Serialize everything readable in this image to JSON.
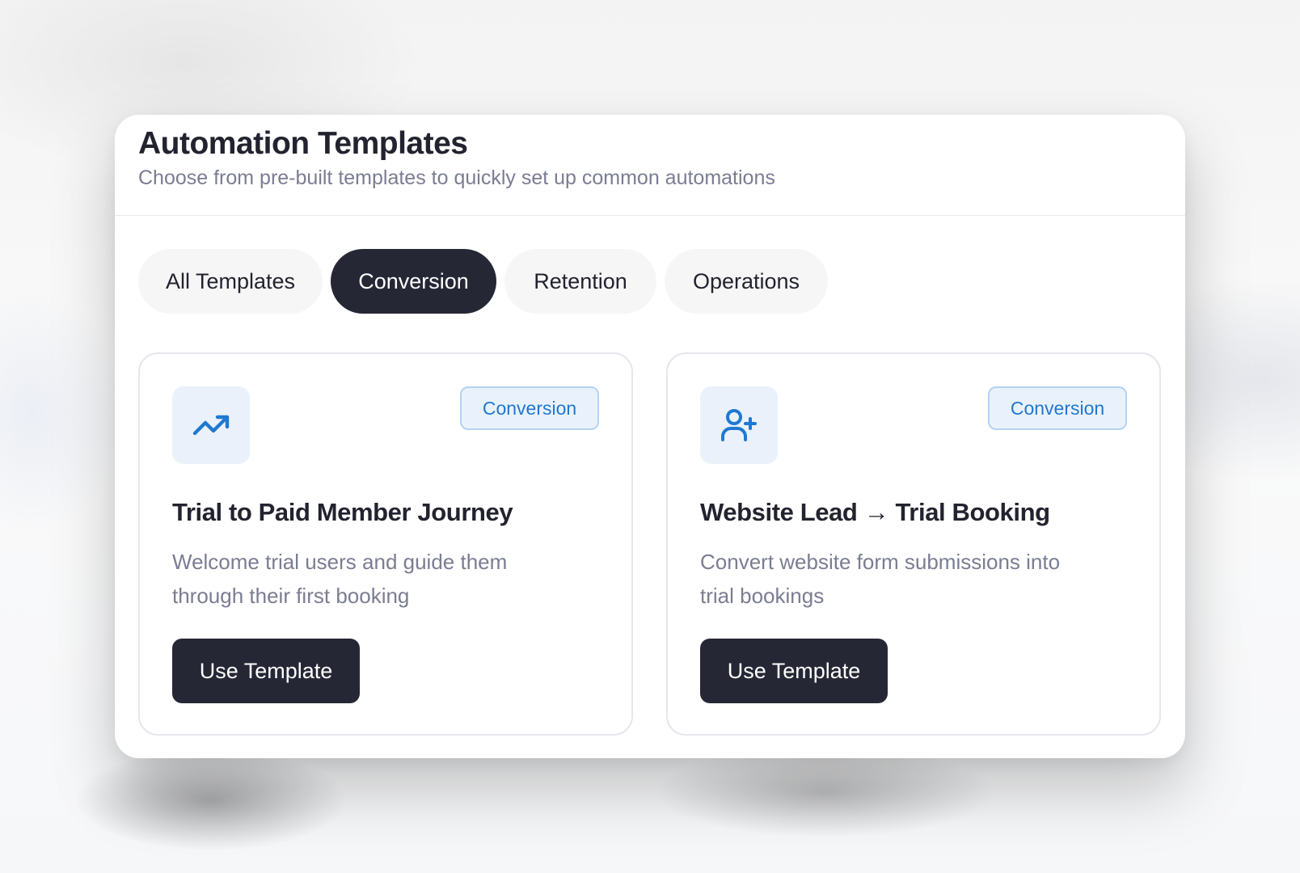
{
  "header": {
    "title": "Automation Templates",
    "subtitle": "Choose from pre-built templates to quickly set up common automations"
  },
  "tabs": [
    {
      "label": "All Templates",
      "active": false
    },
    {
      "label": "Conversion",
      "active": true
    },
    {
      "label": "Retention",
      "active": false
    },
    {
      "label": "Operations",
      "active": false
    }
  ],
  "templates": [
    {
      "icon": "trending-up-icon",
      "badge": "Conversion",
      "title": "Trial to Paid Member Journey",
      "description": "Welcome trial users and guide them through their first booking",
      "button_label": "Use Template"
    },
    {
      "icon": "user-plus-icon",
      "badge": "Conversion",
      "title": "Website Lead → Trial Booking",
      "description": "Convert website form submissions into trial bookings",
      "button_label": "Use Template"
    }
  ],
  "colors": {
    "primary_dark": "#252735",
    "accent_blue": "#1f78d1",
    "badge_bg": "#e9f2fc",
    "icon_bg": "#eaf1fa",
    "muted_text": "#7a7d92"
  }
}
